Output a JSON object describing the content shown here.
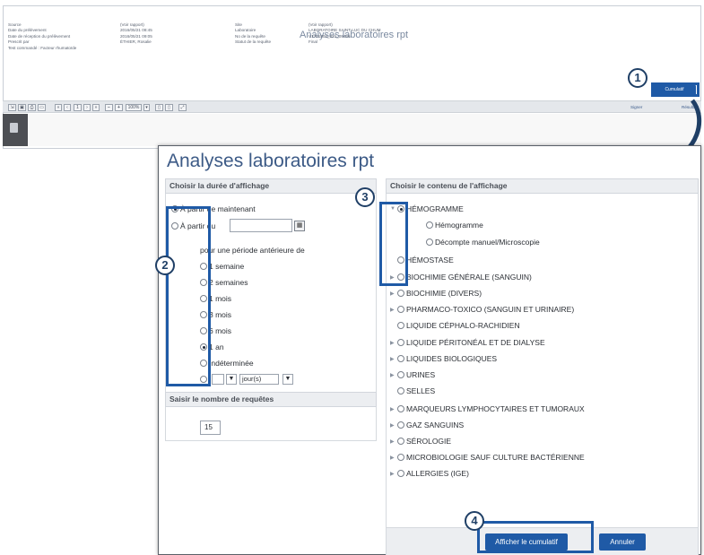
{
  "background_report": {
    "title": "Analyses laboratoires rpt",
    "info_left": {
      "labels": [
        "Source",
        "Date du prélèvement",
        "Date de réception du prélèvement",
        "Prescrit par",
        "Test commandé : Facteur rhumatoïde"
      ],
      "values": [
        "(Voir rapport)",
        "2016/05/21 08:45",
        "2016/05/21 09:05",
        "ÉTHIER, Rosalie"
      ]
    },
    "info_right": {
      "labels": [
        "Site",
        "Laboratoire",
        "No de la requête",
        "Statut de la requête"
      ],
      "values": [
        "(Voir rapport)",
        "LABORATOIRE SAINT-LUC DU CHUM",
        "V1701303_021_09445",
        "Final"
      ]
    },
    "cumulatif_button": "Cumulatif",
    "toolbar": {
      "page": "1",
      "zoom": "100%",
      "link_right_1": "Signer",
      "link_right_2": "Résultats"
    }
  },
  "dialog": {
    "title": "Analyses laboratoires rpt",
    "duration_panel": {
      "header": "Choisir la durée d'affichage",
      "from_now": "À partir de maintenant",
      "from_date": "À partir du",
      "date_value": "",
      "period_caption": "pour une période antérieure de",
      "periods": [
        "1 semaine",
        "2 semaines",
        "1 mois",
        "3 mois",
        "6 mois",
        "1 an",
        "Indéterminée"
      ],
      "selected_period": "1 an",
      "custom_count": "",
      "custom_unit": "jour(s)"
    },
    "requests_panel": {
      "header": "Saisir le nombre de requêtes",
      "value": "15"
    },
    "content_panel": {
      "header": "Choisir le contenu de l'affichage",
      "items": [
        {
          "label": "HÉMOGRAMME",
          "expandable": true,
          "expanded": true,
          "level": 0,
          "selected": true
        },
        {
          "label": "Hémogramme",
          "expandable": false,
          "level": 1
        },
        {
          "label": "Décompte manuel/Microscopie",
          "expandable": false,
          "level": 1
        },
        {
          "label": "HÉMOSTASE",
          "expandable": false,
          "level": 0
        },
        {
          "label": "BIOCHIMIE GÉNÉRALE (SANGUIN)",
          "expandable": true,
          "level": 0
        },
        {
          "label": "BIOCHIMIE (DIVERS)",
          "expandable": true,
          "level": 0
        },
        {
          "label": "PHARMACO-TOXICO (SANGUIN ET URINAIRE)",
          "expandable": true,
          "level": 0
        },
        {
          "label": "LIQUIDE CÉPHALO-RACHIDIEN",
          "expandable": false,
          "level": 0
        },
        {
          "label": "LIQUIDE PÉRITONÉAL ET DE DIALYSE",
          "expandable": true,
          "level": 0
        },
        {
          "label": "LIQUIDES BIOLOGIQUES",
          "expandable": true,
          "level": 0
        },
        {
          "label": "URINES",
          "expandable": true,
          "level": 0
        },
        {
          "label": "SELLES",
          "expandable": false,
          "level": 0
        },
        {
          "label": "MARQUEURS LYMPHOCYTAIRES ET TUMORAUX",
          "expandable": true,
          "level": 0
        },
        {
          "label": "GAZ SANGUINS",
          "expandable": true,
          "level": 0
        },
        {
          "label": "SÉROLOGIE",
          "expandable": true,
          "level": 0
        },
        {
          "label": "MICROBIOLOGIE SAUF CULTURE BACTÉRIENNE",
          "expandable": true,
          "level": 0
        },
        {
          "label": "ALLERGIES (IGE)",
          "expandable": true,
          "level": 0
        }
      ]
    },
    "buttons": {
      "show": "Afficher le cumulatif",
      "cancel": "Annuler"
    }
  },
  "callouts": [
    "1",
    "2",
    "3",
    "4"
  ],
  "colors": {
    "accent": "#1f5aa6",
    "title": "#3c5a86",
    "callout": "#1f3f66"
  }
}
